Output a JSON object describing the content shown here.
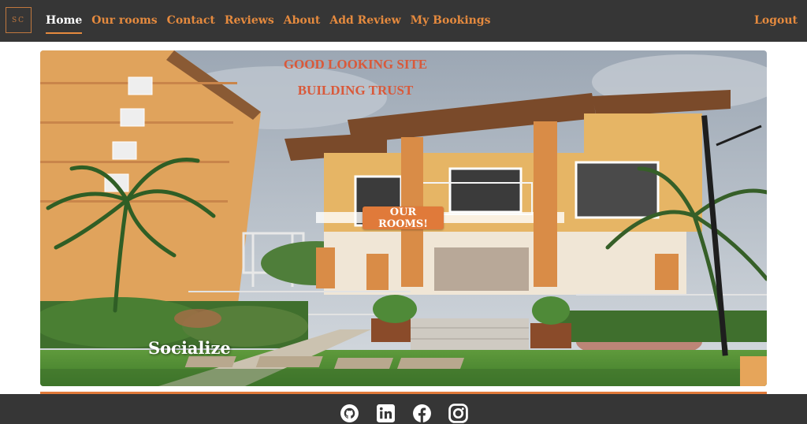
{
  "navbar": {
    "logo_text": "SC",
    "links": [
      {
        "label": "Home",
        "active": true
      },
      {
        "label": "Our rooms"
      },
      {
        "label": "Contact"
      },
      {
        "label": "Reviews"
      },
      {
        "label": "About"
      },
      {
        "label": "Add Review"
      },
      {
        "label": "My Bookings"
      }
    ],
    "logout_label": "Logout"
  },
  "hero": {
    "title_line1": "GOOD LOOKING SITE",
    "title_line2": "BUILDING TRUST",
    "rooms_button": "OUR ROOMS!",
    "caption": "Socialize"
  },
  "footer": {
    "icons": [
      "github-icon",
      "linkedin-icon",
      "facebook-icon",
      "instagram-icon"
    ]
  },
  "colors": {
    "nav_bg": "#363636",
    "accent": "#e07a3a",
    "active_link": "#ffffff"
  }
}
